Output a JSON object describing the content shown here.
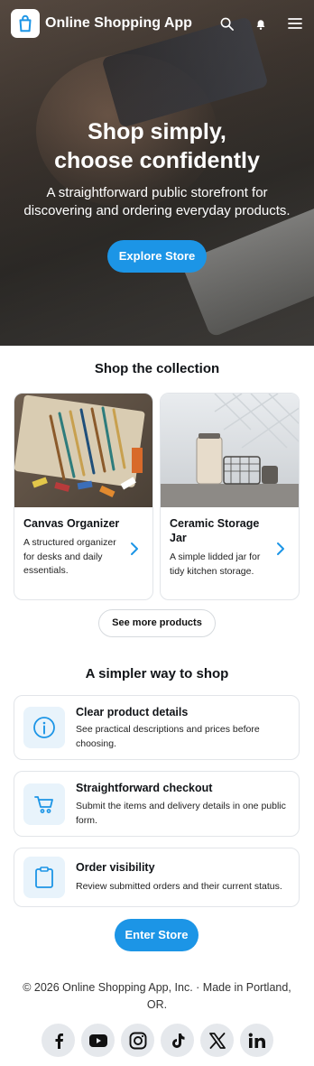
{
  "header": {
    "brand": "Online Shopping App",
    "icons": [
      "shopping-bag-icon",
      "search-icon",
      "notification-bell-icon",
      "menu-icon"
    ]
  },
  "hero": {
    "title_line1": "Shop simply,",
    "title_line2": "choose confidently",
    "subtitle": "A straightforward public storefront for discovering and ordering everyday products.",
    "cta": "Explore Store"
  },
  "collection": {
    "title": "Shop the collection",
    "products": [
      {
        "title": "Canvas Organizer",
        "desc": "A structured organizer for desks and daily essentials."
      },
      {
        "title": "Ceramic Storage Jar",
        "desc": "A simple lidded jar for tidy kitchen storage."
      }
    ],
    "more_label": "See more products"
  },
  "features": {
    "title": "A simpler way to shop",
    "items": [
      {
        "title": "Clear product details",
        "desc": "See practical descriptions and prices before choosing.",
        "icon": "info-icon"
      },
      {
        "title": "Straightforward checkout",
        "desc": "Submit the items and delivery details in one public form.",
        "icon": "cart-icon"
      },
      {
        "title": "Order visibility",
        "desc": "Review submitted orders and their current status.",
        "icon": "clipboard-icon"
      }
    ],
    "cta": "Enter Store"
  },
  "footer": {
    "text": "© 2026 Online Shopping App, Inc. · Made in Portland, OR.",
    "socials": [
      "facebook-icon",
      "youtube-icon",
      "instagram-icon",
      "tiktok-icon",
      "x-icon",
      "linkedin-icon"
    ]
  },
  "colors": {
    "accent": "#1c95e6",
    "icon_bg": "#e8f3fb",
    "social_bg": "#e5e8ec"
  }
}
